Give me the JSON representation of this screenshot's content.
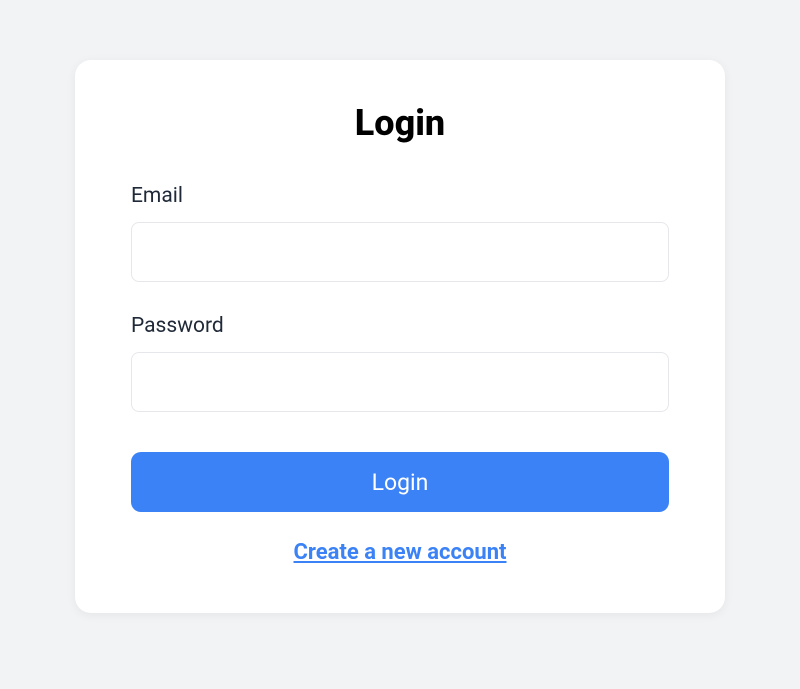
{
  "login": {
    "title": "Login",
    "email_label": "Email",
    "email_value": "",
    "password_label": "Password",
    "password_value": "",
    "submit_label": "Login",
    "create_account_label": "Create a new account"
  }
}
